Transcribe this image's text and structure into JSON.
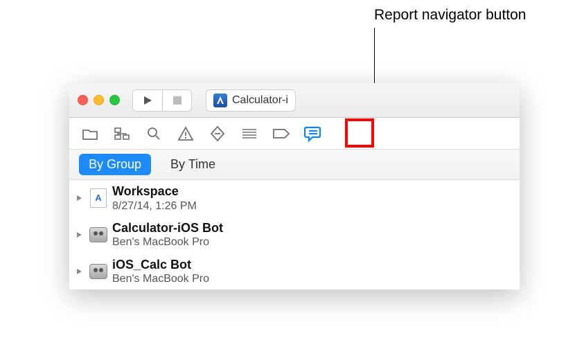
{
  "callout": {
    "label": "Report navigator button"
  },
  "toolbar": {
    "scheme_label": "Calculator-i"
  },
  "filter": {
    "by_group": "By Group",
    "by_time": "By Time"
  },
  "reports": [
    {
      "title": "Workspace",
      "subtitle": "8/27/14, 1:26 PM",
      "icon": "doc"
    },
    {
      "title": "Calculator-iOS Bot",
      "subtitle": "Ben's MacBook Pro",
      "icon": "bot"
    },
    {
      "title": "iOS_Calc Bot",
      "subtitle": "Ben's MacBook Pro",
      "icon": "bot"
    }
  ]
}
